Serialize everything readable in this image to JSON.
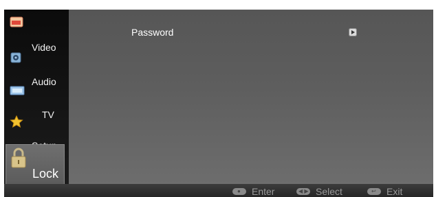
{
  "sidebar": {
    "items": [
      {
        "label": "Video",
        "icon": "video-icon"
      },
      {
        "label": "Audio",
        "icon": "audio-icon"
      },
      {
        "label": "TV",
        "icon": "tv-icon"
      },
      {
        "label": "Setup",
        "icon": "star-icon"
      },
      {
        "label": "Lock",
        "icon": "lock-icon",
        "selected": true
      }
    ]
  },
  "main": {
    "items": [
      {
        "label": "Password",
        "icon": "arrow-right-icon"
      }
    ]
  },
  "footer": {
    "hints": [
      {
        "label": "Enter",
        "icon": "ok-key-icon"
      },
      {
        "label": "Select",
        "icon": "nav-keys-icon"
      },
      {
        "label": "Exit",
        "icon": "return-key-icon"
      }
    ]
  },
  "colors": {
    "content_bg": "#5e5e5e",
    "sidebar_bg": "#111111",
    "selected_bg": "#666666",
    "footer_text": "#9a9a9a"
  }
}
